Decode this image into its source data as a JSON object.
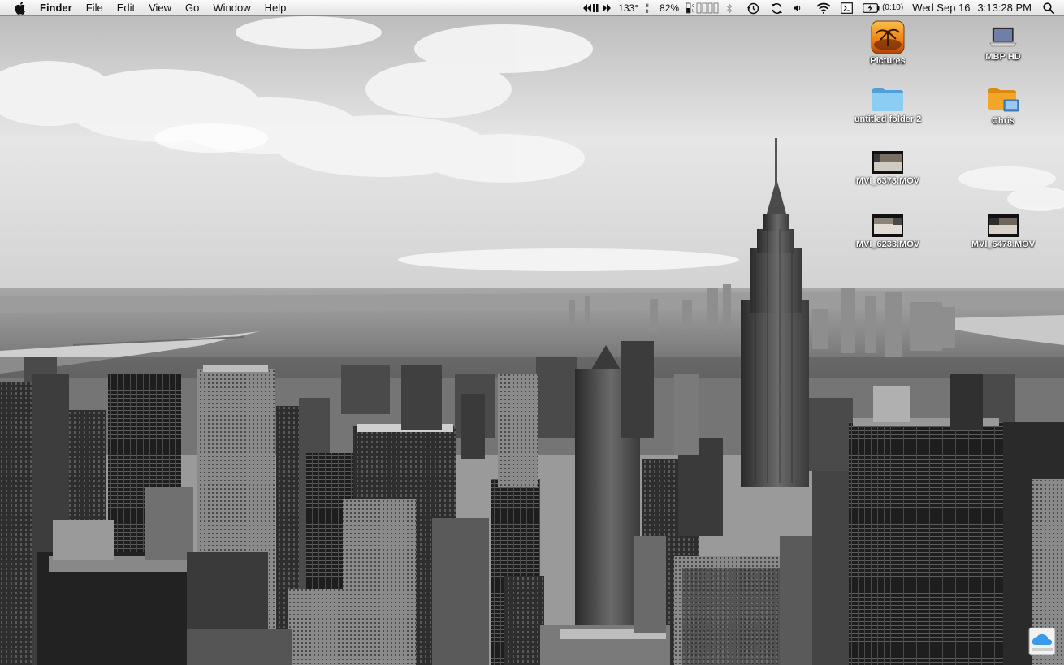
{
  "menubar": {
    "app_name": "Finder",
    "menus": [
      "File",
      "Edit",
      "View",
      "Go",
      "Window",
      "Help"
    ],
    "status": {
      "temperature": "133°",
      "battery_percent": "82%",
      "timer": "(0:10)",
      "date": "Wed Sep 16",
      "time": "3:13:28 PM"
    },
    "icons": [
      "apple-icon",
      "media-controls-icon",
      "hdd-indicator-icon",
      "cpu-meter-icon",
      "bluetooth-icon",
      "time-machine-icon",
      "sync-icon",
      "volume-icon",
      "wifi-icon",
      "keyboard-icon",
      "battery-icon",
      "spotlight-icon"
    ]
  },
  "desktop": {
    "icons": [
      {
        "name": "pictures",
        "label": "Pictures",
        "type": "photo-folder-icon"
      },
      {
        "name": "mbp-hd",
        "label": "MBP HD",
        "type": "laptop-drive-icon"
      },
      {
        "name": "untitled-folder-2",
        "label": "untitled folder 2",
        "type": "folder-icon"
      },
      {
        "name": "chris",
        "label": "Chris",
        "type": "home-folder-icon"
      },
      {
        "name": "mvi-6373",
        "label": "MVI_6373.MOV",
        "type": "movie-thumbnail-icon"
      },
      {
        "name": "mvi-6233",
        "label": "MVI_6233.MOV",
        "type": "movie-thumbnail-icon"
      },
      {
        "name": "mvi-6478",
        "label": "MVI_6478.MOV",
        "type": "movie-thumbnail-icon"
      }
    ],
    "wallpaper": "black-and-white New York City skyline with Empire State Building",
    "corner_icon": "icloud-drive-icon"
  },
  "colors": {
    "menubar_top": "#fafafa",
    "menubar_bottom": "#e2e2e2",
    "folder_blue": "#6cb6e6",
    "home_folder_orange": "#f3a626",
    "pictures_orange": "#f07d12"
  }
}
